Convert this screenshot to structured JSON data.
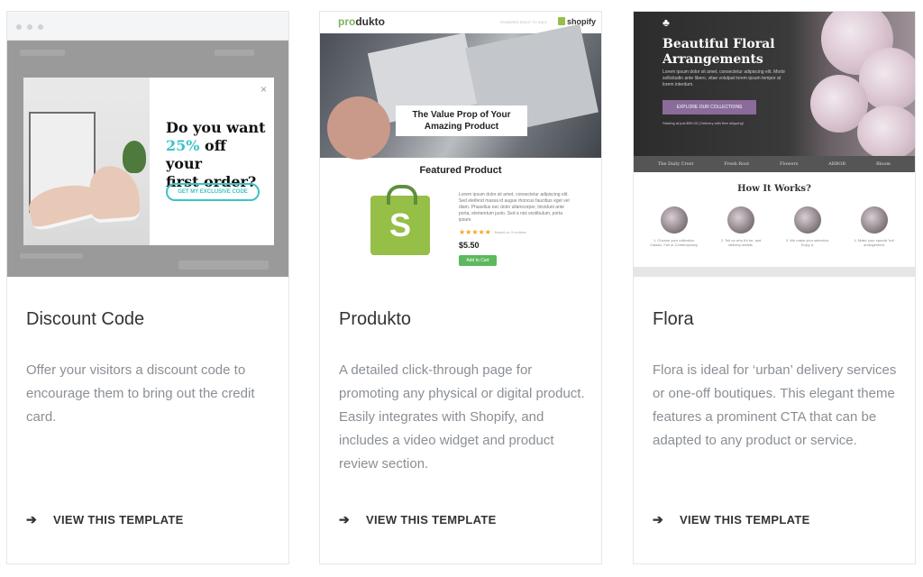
{
  "cards": [
    {
      "title": "Discount Code",
      "description": "Offer your visitors a discount code to encourage them to bring out the credit card.",
      "link_label": "VIEW THIS TEMPLATE",
      "arrow_icon": "arrow-right-icon",
      "preview": {
        "headline_line1": "Do you want",
        "headline_accent": "25%",
        "headline_line2": " off your",
        "headline_line3": "first order?",
        "cta": "GET MY EXCLUSIVE CODE",
        "close": "×",
        "accent_color": "#39c4c8"
      }
    },
    {
      "title": "Produkto",
      "description": "A detailed click-through page for promoting any physical or digital product. Easily integrates with Shopify, and includes a video widget and product review section.",
      "link_label": "VIEW THIS TEMPLATE",
      "arrow_icon": "arrow-right-icon",
      "preview": {
        "logo_prefix": "pro",
        "logo_suffix": "dukto",
        "powered_by": "POWERED RIGHT TO SALE",
        "shopify": "shopify",
        "value_prop": "The Value Prop of Your Amazing Product",
        "featured": "Featured Product",
        "lorem": "Lorem ipsum dolor sit amet, consectetur adipiscing elit. Sed eleifend massa id augue rhoncus faucibus eget vel diam. Phasellus nec dolor ullamcorper, tincidunt ante porta, elementum justo. Sed a nisi vestibulum, porta ipsum.",
        "stars": "★★★★★",
        "reviews": "Based on 3 reviews",
        "price": "$5.50",
        "cart": "Add to Cart",
        "accent_color": "#7ab55c"
      }
    },
    {
      "title": "Flora",
      "description": "Flora is ideal for ‘urban’ delivery services or one-off boutiques. This elegant theme features a prominent CTA that can be adapted to any product or service.",
      "link_label": "VIEW THIS TEMPLATE",
      "arrow_icon": "arrow-right-icon",
      "preview": {
        "logo": "♣",
        "title": "Beautiful Floral Arrangements",
        "subtitle": "Lorem ipsum dolor sit amet, consectetur adipiscing elit. Morbi sollicitudin ante libero, vitae volutpat lorem ipsum tempor at lorem interdum.",
        "cta": "EXPLORE OUR COLLECTIONS",
        "note": "Starting at just $59.00 | Delivery with free shipping!",
        "brands": [
          "The Daily Crest",
          "Fresh Root",
          "Flowers",
          "ARBOR",
          "Bloom"
        ],
        "how": "How It Works?",
        "steps": [
          "1. Choose your collection. Classic, Fall or Contemporary.",
          "2. Tell us who it's for, and delivery details.",
          "3. We make your selection. Enjoy it.",
          "4. Make your special 'hot' arrangement."
        ],
        "accent_color": "#8a6b9a"
      }
    }
  ]
}
